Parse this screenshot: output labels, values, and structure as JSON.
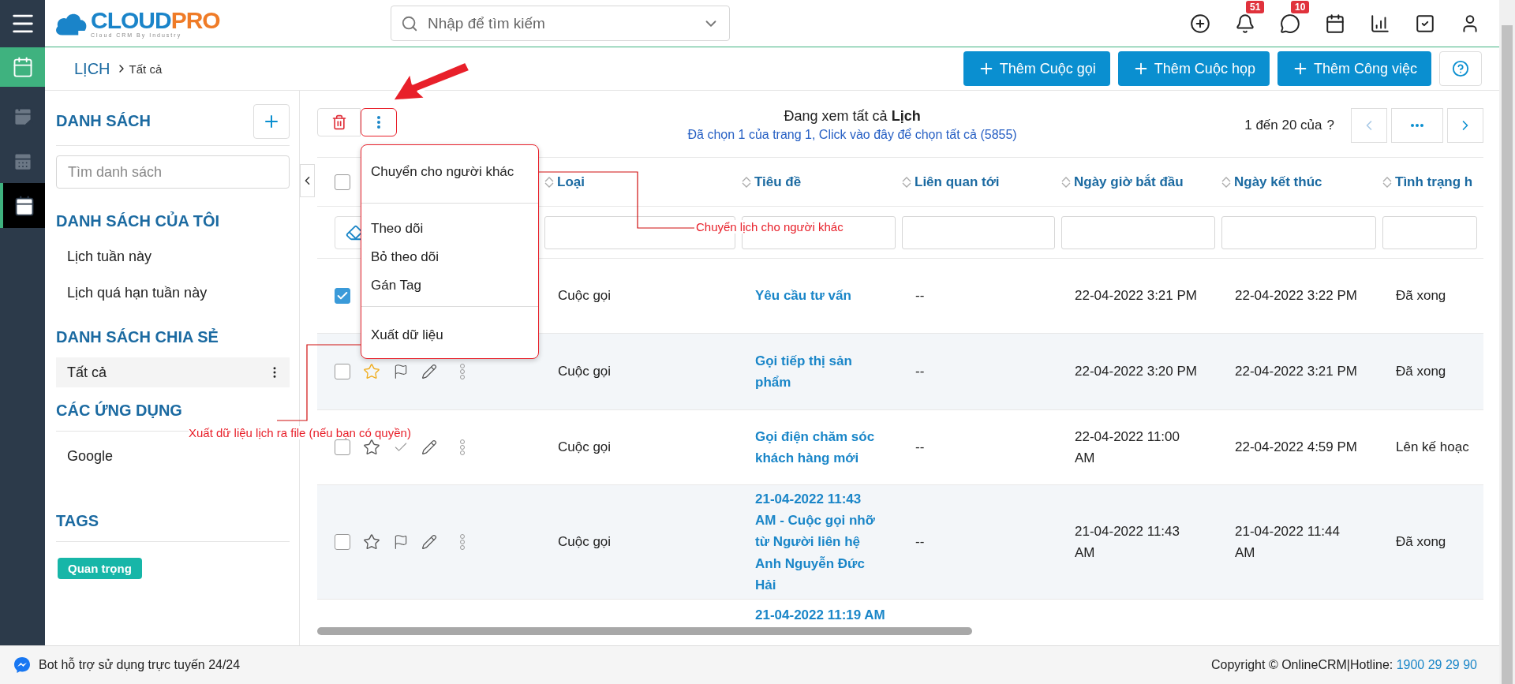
{
  "rail": {
    "items": [
      {
        "kind": "module",
        "selected": false
      },
      {
        "kind": "list",
        "selected": false
      },
      {
        "kind": "grid",
        "selected": false
      },
      {
        "kind": "day",
        "selected": true
      }
    ]
  },
  "topbar": {
    "logo": {
      "part_1": "CLOUD",
      "part_2": "PRO",
      "tagline": "Cloud CRM By Industry"
    },
    "search": {
      "placeholder": "Nhập để tìm kiếm"
    },
    "actions": [
      {
        "kind": "add"
      },
      {
        "kind": "notifications",
        "badge": "51"
      },
      {
        "kind": "messages",
        "badge": "10"
      },
      {
        "kind": "calendar"
      },
      {
        "kind": "reports"
      },
      {
        "kind": "tasks"
      },
      {
        "kind": "profile"
      }
    ]
  },
  "breadcrumb": {
    "module": "LỊCH",
    "current": "Tất cả"
  },
  "header_buttons": [
    "Thêm Cuộc gọi",
    "Thêm Cuộc họp",
    "Thêm Công việc"
  ],
  "sidebar": {
    "title": "DANH SÁCH",
    "search_placeholder": "Tìm danh sách",
    "sections": [
      {
        "title": "DANH SÁCH CỦA TÔI",
        "ruled": false,
        "items": [
          {
            "label": "Lịch tuần này",
            "selected": false
          },
          {
            "label": "Lịch quá hạn tuần này",
            "selected": false
          }
        ]
      },
      {
        "title": "DANH SÁCH CHIA SẺ",
        "ruled": false,
        "items": [
          {
            "label": "Tất cả",
            "selected": true
          }
        ]
      },
      {
        "title": "CÁC ỨNG DỤNG",
        "ruled": true,
        "items": [
          {
            "label": "Google",
            "selected": false
          }
        ]
      }
    ],
    "tags_title": "TAGS",
    "tags": [
      {
        "label": "Quan trọng",
        "color": "#17b6a8"
      }
    ]
  },
  "toolbar": {
    "summary": "Đang xem tất cả **Lịch**",
    "selection_link": "Đã chọn 1 của trang 1, Click vào đây để chọn tất cả (5855)",
    "pager": {
      "range": "1 đến 20 của",
      "total": "?",
      "prev_disabled": true
    }
  },
  "menu": {
    "open": true,
    "groups": [
      [
        "Chuyển cho người khác"
      ],
      [
        "Theo dõi",
        "Bỏ theo dõi",
        "Gán Tag"
      ],
      [
        "Xuất dữ liệu"
      ]
    ]
  },
  "table": {
    "all_checked": false,
    "columns": [
      "Loại",
      "Tiêu đề",
      "Liên quan tới",
      "Ngày giờ bắt đầu",
      "Ngày kết thúc",
      "Tình trạng h"
    ],
    "rows": [
      {
        "selected": true,
        "type": "Cuộc gọi",
        "title": "Yêu cầu tư vấn",
        "related": "--",
        "start": "22-04-2022 3:21 PM",
        "end": "22-04-2022 3:22 PM",
        "status": "Đã xong"
      },
      {
        "selected": false,
        "actions": {
          "starred": true,
          "kind": "flag"
        },
        "type": "Cuộc gọi",
        "title": "Gọi tiếp thị sản phẩm",
        "related": "--",
        "start": "22-04-2022 3:20 PM",
        "end": "22-04-2022 3:21 PM",
        "status": "Đã xong"
      },
      {
        "selected": false,
        "actions": {
          "starred": false,
          "kind": "check"
        },
        "type": "Cuộc gọi",
        "title": "Gọi điện chăm sóc khách hàng mới",
        "related": "--",
        "start": "22-04-2022 11:00 AM",
        "end": "22-04-2022 4:59 PM",
        "status": "Lên kế hoạc"
      },
      {
        "selected": false,
        "actions": {
          "starred": false,
          "kind": "flag"
        },
        "type": "Cuộc gọi",
        "title": "21-04-2022 11:43 AM - Cuộc gọi nhỡ từ Người liên hệ Anh Nguyễn Đức Hải",
        "related": "--",
        "start": "21-04-2022 11:43 AM",
        "end": "21-04-2022 11:44 AM",
        "status": "Đã xong"
      },
      {
        "title": "21-04-2022 11:19 AM"
      }
    ]
  },
  "annotations": [
    {
      "kind": "arrow"
    },
    {
      "kind": "callout",
      "text": "Chuyển lịch cho người khác"
    },
    {
      "kind": "callout",
      "text": "Xuất dữ liệu lịch ra file (nếu bạn có quyền)"
    }
  ],
  "footer": {
    "bot": "Bot hỗ trợ sử dụng trực tuyến 24/24",
    "copyright": "Copyright © OnlineCRM|Hotline: ",
    "hotline": "1900 29 29 90"
  }
}
